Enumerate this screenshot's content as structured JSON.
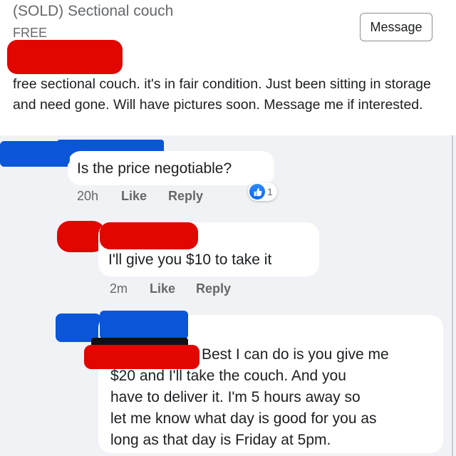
{
  "listing": {
    "title": "(SOLD) Sectional couch",
    "price": "FREE",
    "message_button": "Message",
    "description": "free sectional couch. it's in fair condition. Just been sitting in storage and need gone. Will have pictures soon. Message me if interested."
  },
  "comments": [
    {
      "text": "Is the price negotiable?",
      "time": "20h",
      "like_label": "Like",
      "reply_label": "Reply",
      "reaction_count": "1"
    },
    {
      "text": "I'll give you $10 to take it",
      "time": "2m",
      "like_label": "Like",
      "reply_label": "Reply"
    },
    {
      "text_lines": [
        "Best I can do is you give me",
        "$20 and I'll take the couch. And you",
        "have to deliver it. I'm 5 hours away so",
        "let me know what day is good for you as",
        "long as that day is Friday at 5pm."
      ]
    }
  ],
  "colors": {
    "redaction_red": "#e10600",
    "redaction_blue": "#0a55d8",
    "like_blue": "#0866ff"
  }
}
